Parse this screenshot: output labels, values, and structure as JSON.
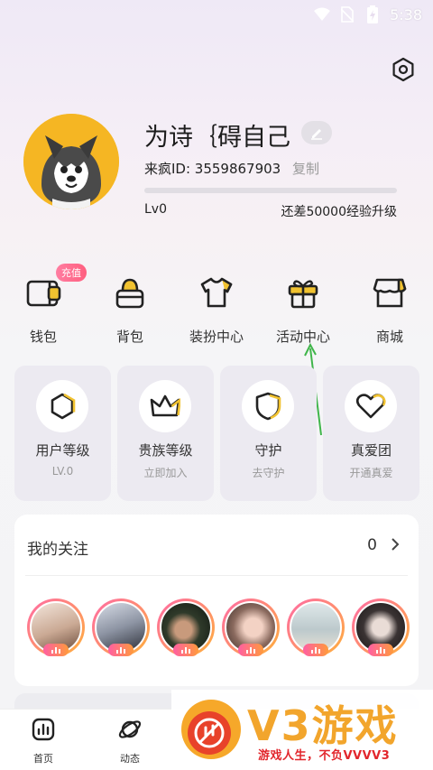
{
  "status_bar": {
    "time": "5:38",
    "icons": [
      "wifi-icon",
      "no-sim-icon",
      "battery-icon"
    ]
  },
  "header": {
    "settings_icon": "settings-icon"
  },
  "profile": {
    "username": "为诗｛碍自己",
    "id_text": "来疯ID: 3559867903",
    "copy_label": "复制",
    "level": "Lv0",
    "exp_hint": "还差50000经验升级",
    "progress_value": 0,
    "avatar": "husky-avatar"
  },
  "quick_menu": {
    "badge": "充值",
    "items": [
      {
        "label": "钱包",
        "icon": "wallet-icon"
      },
      {
        "label": "背包",
        "icon": "backpack-icon"
      },
      {
        "label": "装扮中心",
        "icon": "tshirt-icon"
      },
      {
        "label": "活动中心",
        "icon": "gift-icon"
      },
      {
        "label": "商城",
        "icon": "store-icon"
      }
    ]
  },
  "cards": [
    {
      "title": "用户等级",
      "sub": "LV.0",
      "icon": "hexagon-icon"
    },
    {
      "title": "贵族等级",
      "sub": "立即加入",
      "icon": "crown-icon"
    },
    {
      "title": "守护",
      "sub": "去守护",
      "icon": "shield-icon"
    },
    {
      "title": "真爱团",
      "sub": "开通真爱",
      "icon": "heart-icon"
    }
  ],
  "follow": {
    "title": "我的关注",
    "count": "0",
    "friends": [
      {
        "name": "friend-1"
      },
      {
        "name": "friend-2"
      },
      {
        "name": "friend-3"
      },
      {
        "name": "friend-4"
      },
      {
        "name": "friend-5"
      },
      {
        "name": "friend-6"
      }
    ]
  },
  "tabbar": {
    "items": [
      {
        "label": "首页",
        "icon": "home-chart-icon"
      },
      {
        "label": "动态",
        "icon": "planet-icon"
      }
    ]
  },
  "watermark": {
    "brand": "V3游戏",
    "slogan": "游戏人生，不负VVVV3"
  },
  "colors": {
    "accent_yellow": "#f1c230",
    "badge_pink": "#ff6a92",
    "watermark_orange": "#f2a52c",
    "watermark_red": "#e2262c"
  }
}
